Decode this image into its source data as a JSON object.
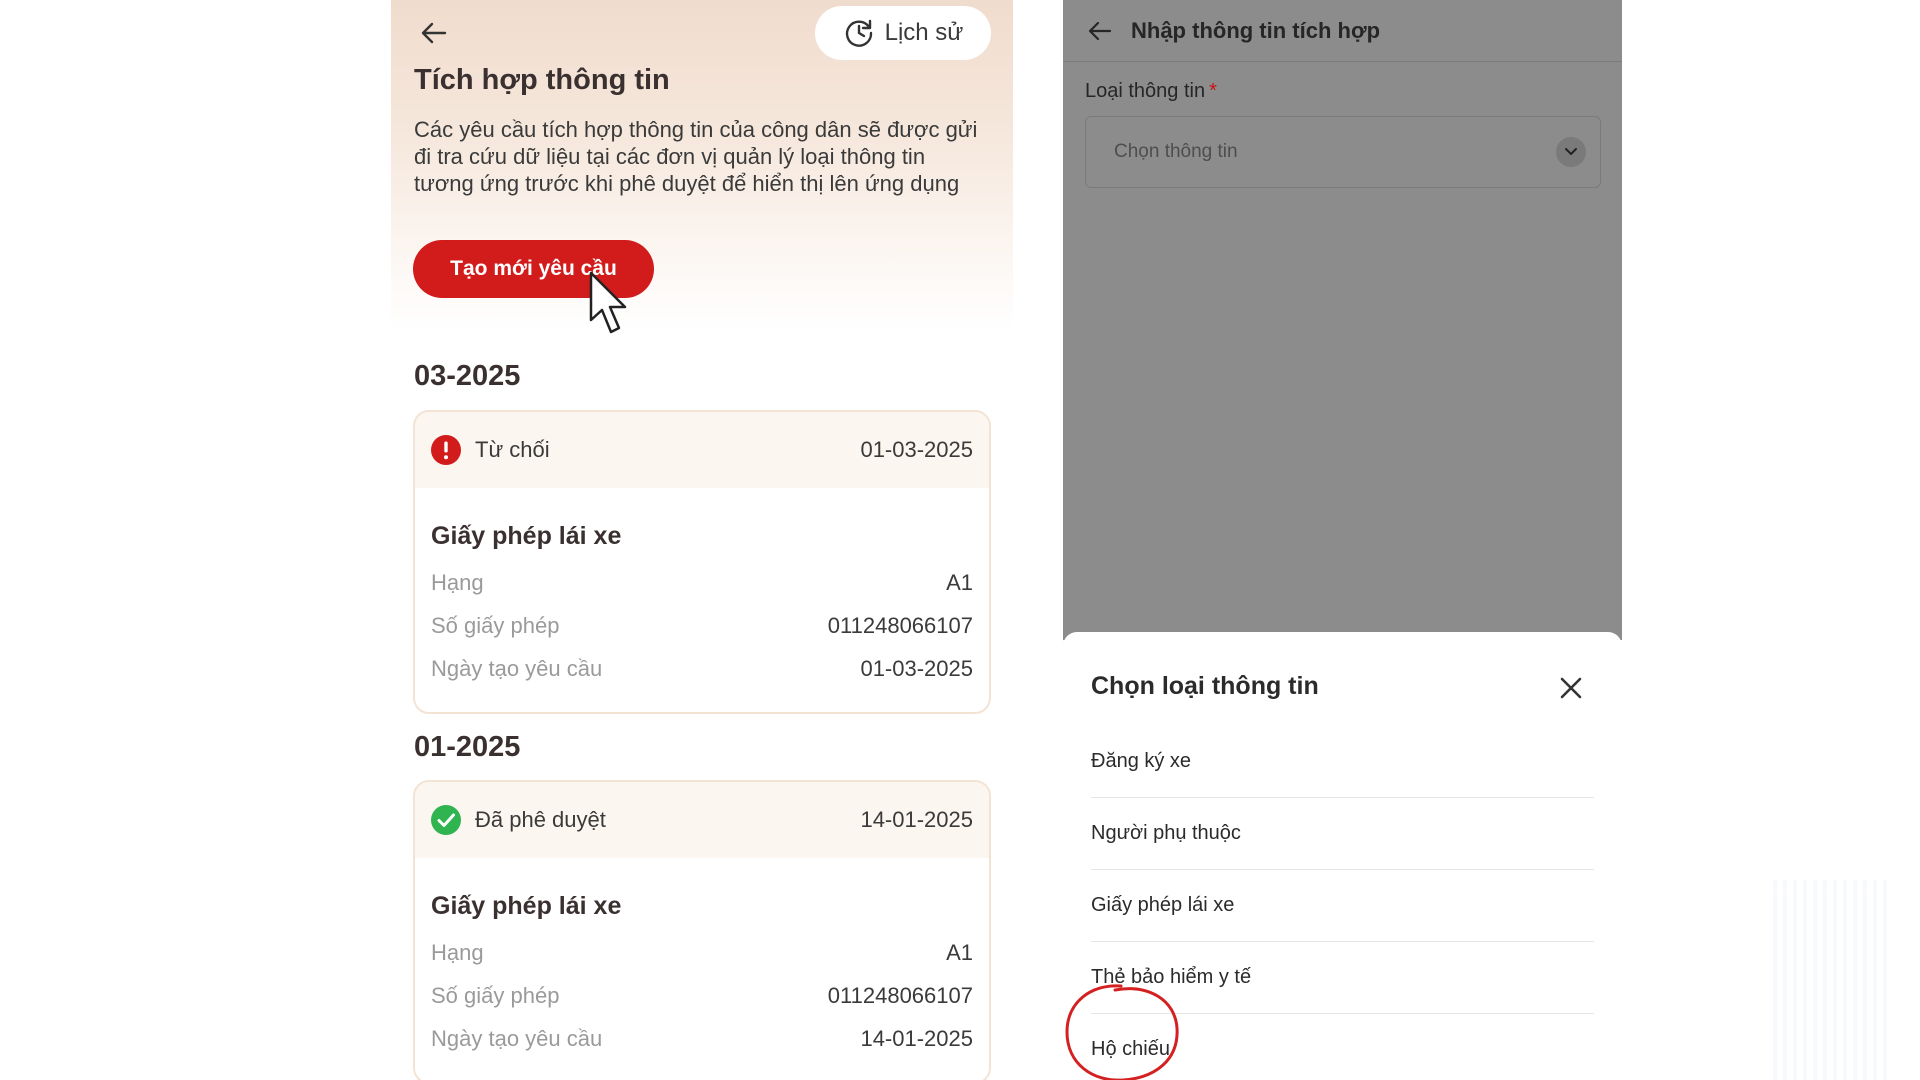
{
  "left": {
    "history_label": "Lịch sử",
    "title": "Tích hợp thông tin",
    "description": "Các yêu cầu tích hợp thông tin của công dân sẽ được gửi đi tra cứu dữ liệu tại các đơn vị quản lý loại thông tin tương ứng trước khi phê duyệt để hiển thị lên ứng dụng",
    "create_button": "Tạo mới yêu cầu",
    "groups": [
      {
        "month": "03-2025",
        "status": "Từ chối",
        "status_color": "#d21b1b",
        "date": "01-03-2025",
        "doc_title": "Giấy phép lái xe",
        "rows": [
          {
            "label": "Hạng",
            "value": "A1"
          },
          {
            "label": "Số giấy phép",
            "value": "011248066107"
          },
          {
            "label": "Ngày tạo yêu cầu",
            "value": "01-03-2025"
          }
        ]
      },
      {
        "month": "01-2025",
        "status": "Đã phê duyệt",
        "status_color": "#2fb450",
        "date": "14-01-2025",
        "doc_title": "Giấy phép lái xe",
        "rows": [
          {
            "label": "Hạng",
            "value": "A1"
          },
          {
            "label": "Số giấy phép",
            "value": "011248066107"
          },
          {
            "label": "Ngày tạo yêu cầu",
            "value": "14-01-2025"
          }
        ]
      }
    ]
  },
  "right": {
    "header_title": "Nhập thông tin tích hợp",
    "field_label": "Loại thông tin",
    "required_mark": "*",
    "select_placeholder": "Chọn thông tin",
    "sheet_title": "Chọn loại thông tin",
    "options": [
      "Đăng ký xe",
      "Người phụ thuộc",
      "Giấy phép lái xe",
      "Thẻ bảo hiểm y tế",
      "Hộ chiếu"
    ]
  },
  "colors": {
    "accent": "#d21b1b",
    "approved": "#2fb450",
    "overlay": "#8c8c8c",
    "annotation": "#d42020"
  }
}
